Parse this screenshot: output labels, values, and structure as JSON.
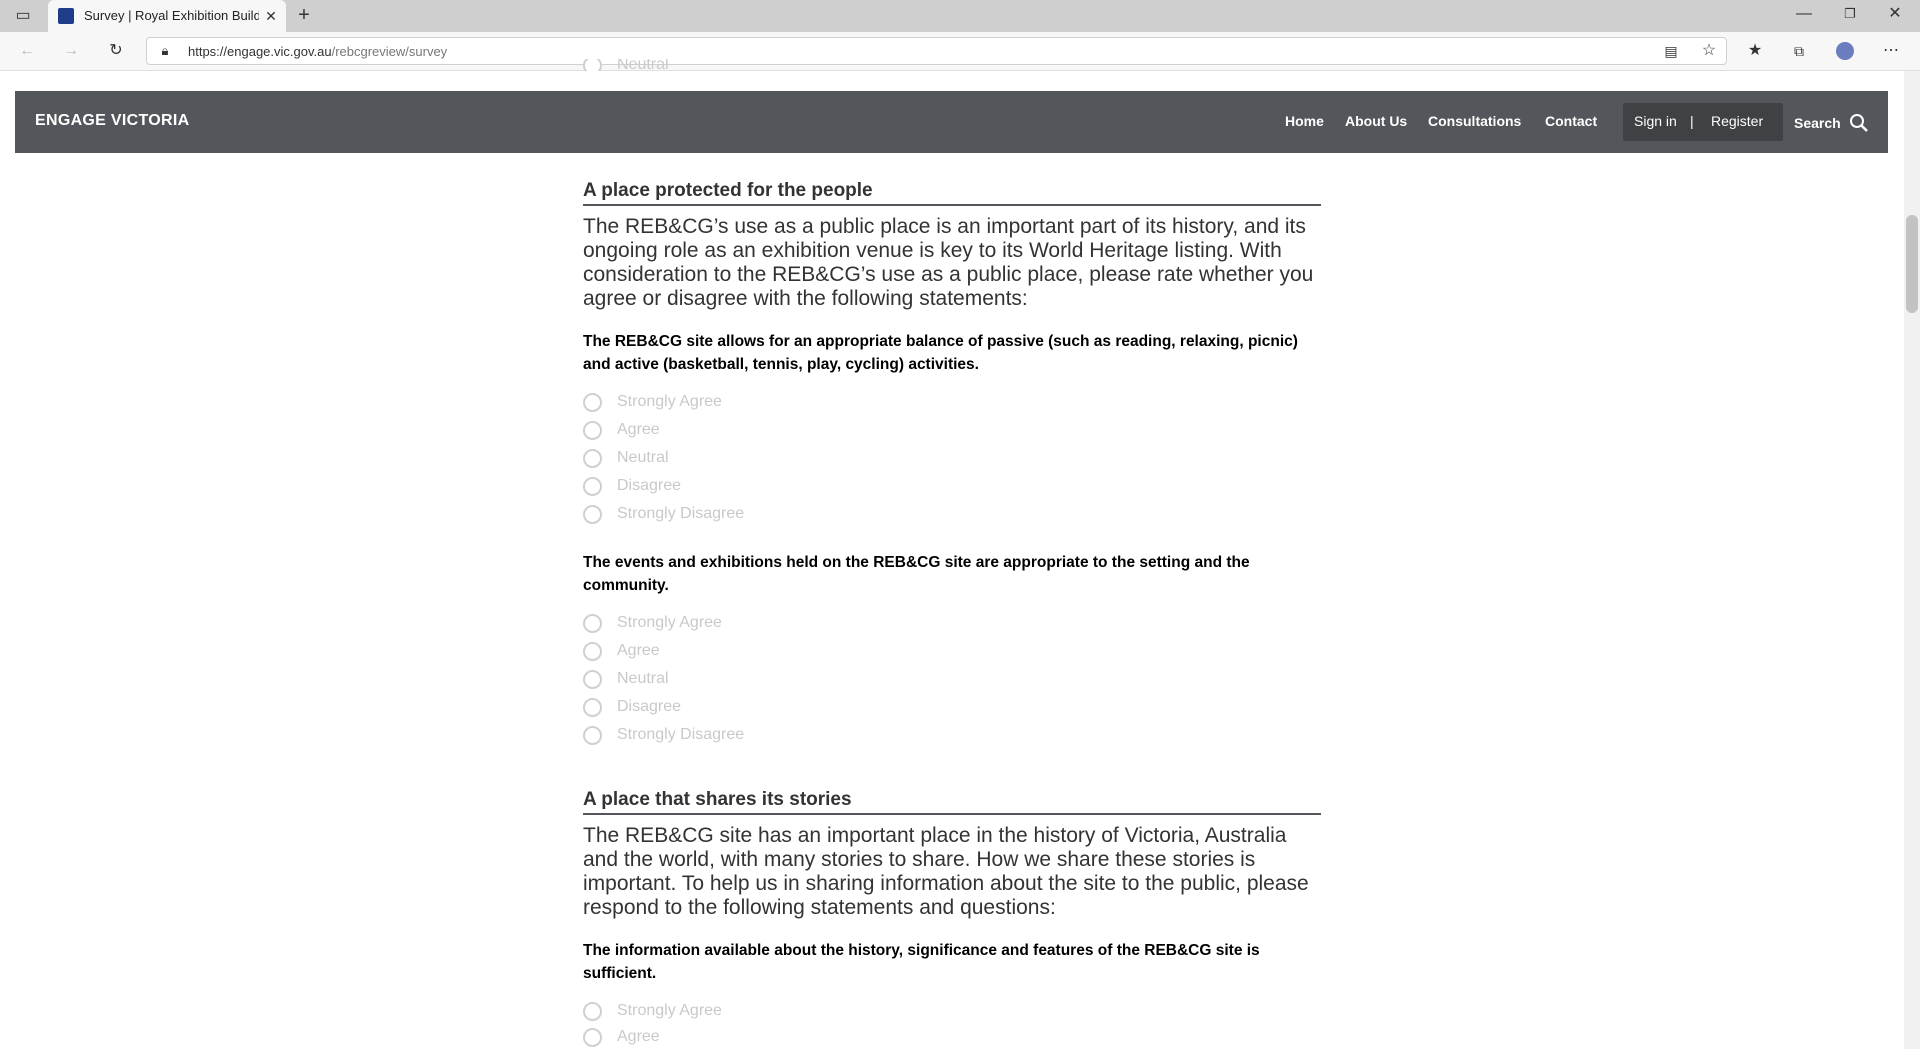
{
  "browser": {
    "tab_title": "Survey | Royal Exhibition Building",
    "url": "https://engage.vic.gov.au/rebcgreview/survey",
    "url_host": "https://engage.vic.gov.au",
    "url_path": "/rebcgreview/survey",
    "icons": [
      "sidebar-toggle-icon",
      "favicon-icon",
      "tab-close-icon",
      "new-tab-icon",
      "minimize-icon",
      "restore-icon",
      "close-window-icon",
      "back-icon",
      "forward-icon",
      "refresh-icon",
      "lock-icon",
      "reader-view-icon",
      "add-favorite-icon",
      "favorites-icon",
      "collections-icon",
      "profile-icon",
      "more-icon"
    ]
  },
  "header": {
    "logo": "ENGAGE VICTORIA",
    "nav": [
      "Home",
      "About Us",
      "Consultations",
      "Contact"
    ],
    "sign_in": "Sign in",
    "separator": "|",
    "register": "Register",
    "search": "Search"
  },
  "partial_option": "Neutral",
  "sections": [
    {
      "title": "A place protected for the people",
      "intro": "The REB&CG’s use as a public place is an important part of its history, and its ongoing role as an exhibition venue is key to its World Heritage listing. With consideration to the REB&CG’s use as a public place, please rate whether you agree or disagree with the following statements:",
      "questions": [
        {
          "text": "The REB&CG site allows for an appropriate balance of passive (such as reading, relaxing, picnic) and active (basketball, tennis, play, cycling) activities.",
          "options": [
            "Strongly Agree",
            "Agree",
            "Neutral",
            "Disagree",
            "Strongly Disagree"
          ]
        },
        {
          "text": "The events and exhibitions held on the REB&CG site are appropriate to the setting and the community.",
          "options": [
            "Strongly Agree",
            "Agree",
            "Neutral",
            "Disagree",
            "Strongly Disagree"
          ]
        }
      ]
    },
    {
      "title": "A place that shares its stories",
      "intro": "The REB&CG site has an important place in the history of Victoria, Australia and the world, with many stories to share. How we share these stories is important. To help us in sharing information about the site to the public, please respond to the following statements and questions:",
      "questions": [
        {
          "text": "The information available about the history, significance and features of the REB&CG site is sufficient.",
          "options": [
            "Strongly Agree",
            "Agree"
          ]
        }
      ]
    }
  ],
  "colors": {
    "header_bg": "#53565a",
    "auth_bg": "#3f4144",
    "option_text": "#c9c9c9"
  }
}
